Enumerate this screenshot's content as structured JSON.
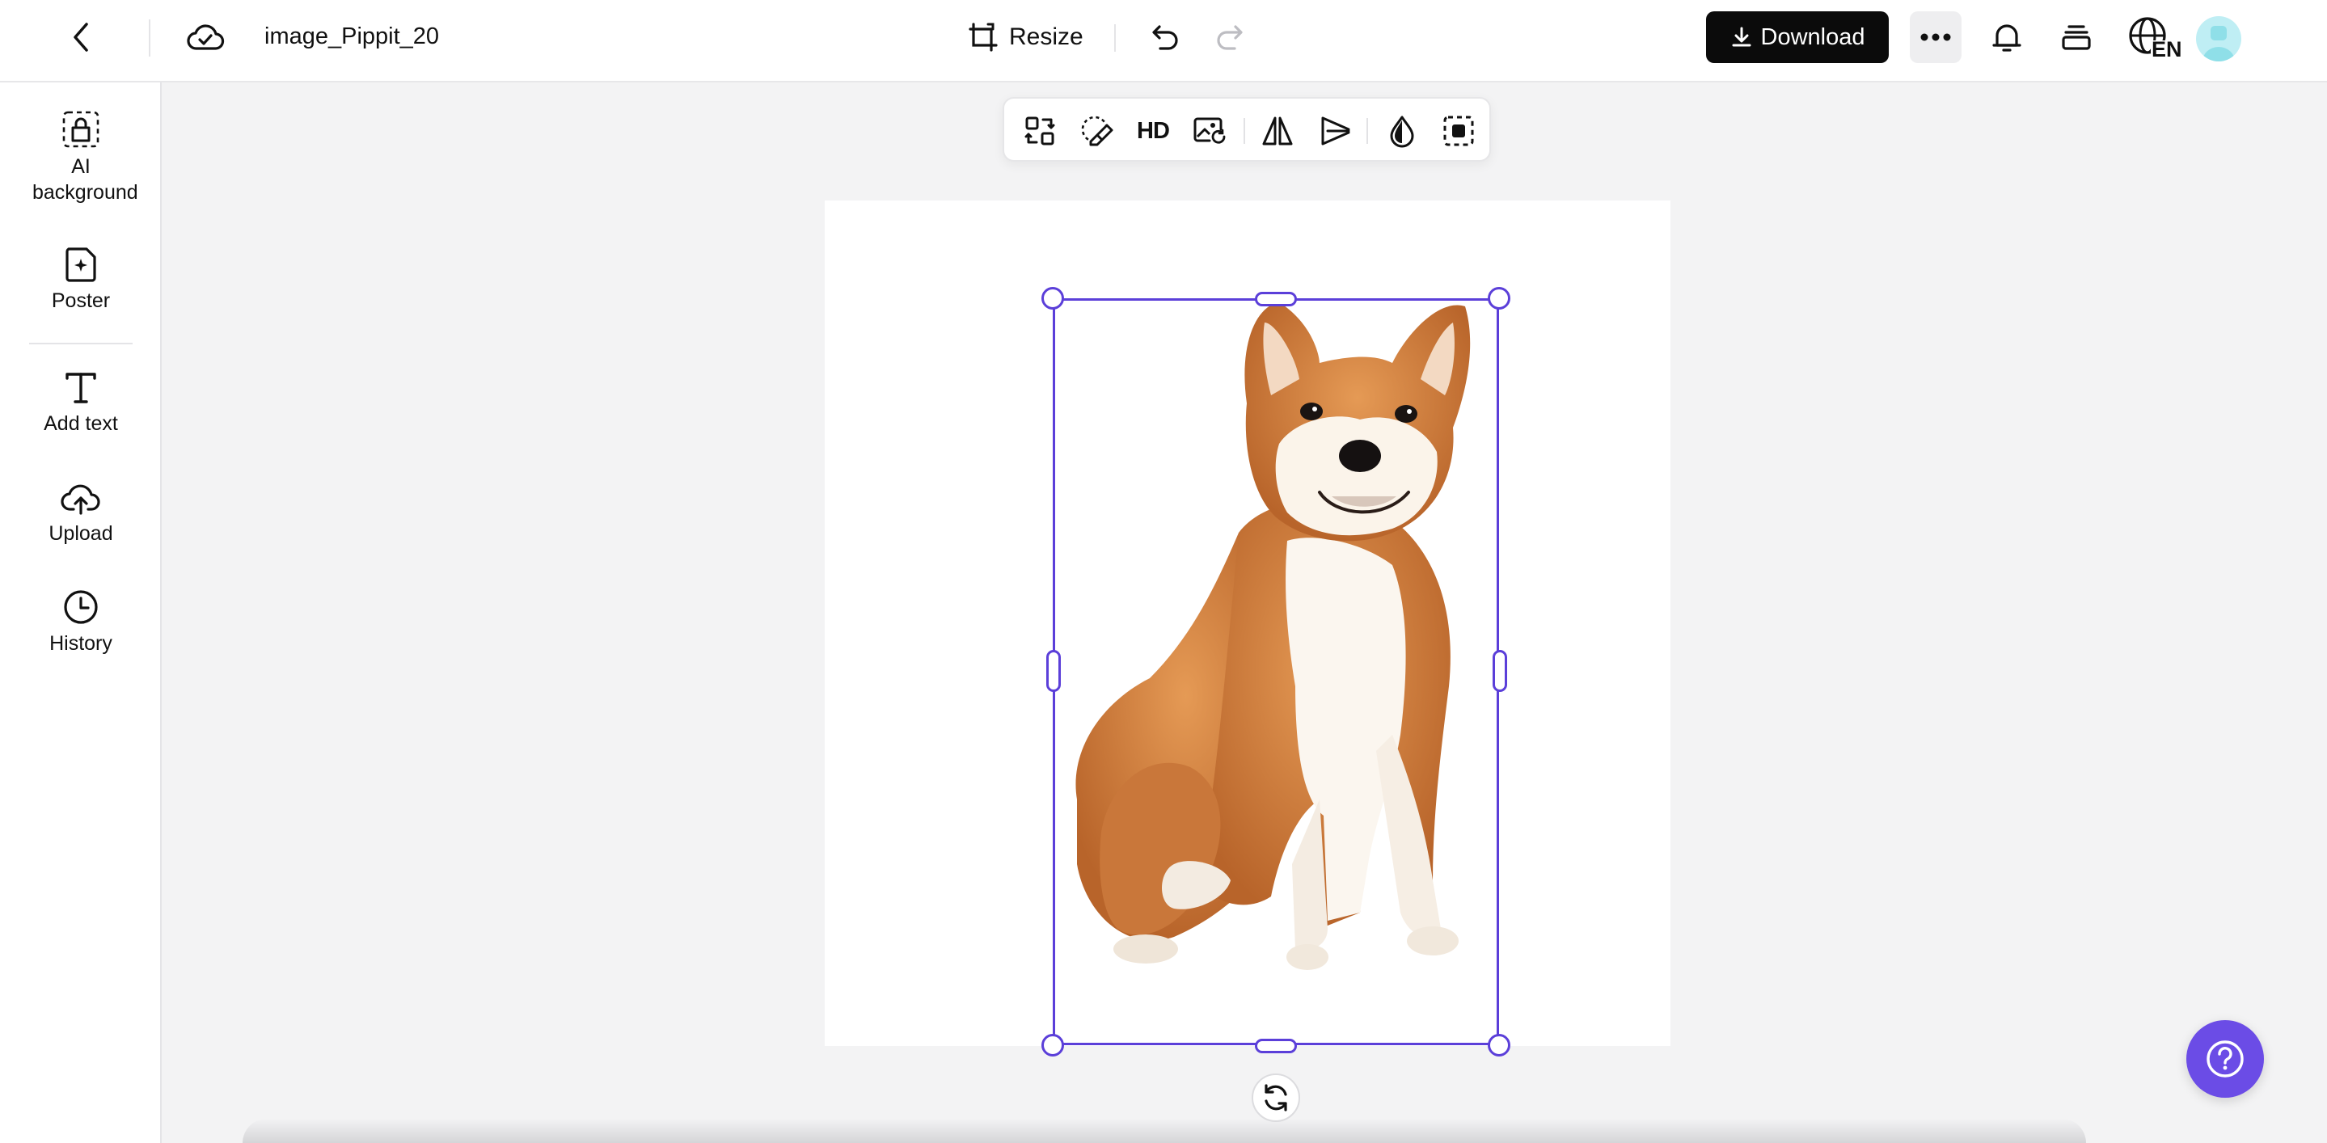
{
  "header": {
    "back_icon": "chevron-left-icon",
    "cloud_icon": "cloud-check-icon",
    "file_title": "image_Pippit_20",
    "resize_label": "Resize",
    "undo_icon": "undo-icon",
    "redo_icon": "redo-icon",
    "download_label": "Download",
    "more_icon": "more-icon",
    "notifications_icon": "bell-icon",
    "layers_icon": "layers-icon",
    "language_label": "EN",
    "accent_color": "#5b3fd9"
  },
  "sidebar": {
    "items": [
      {
        "label": "AI background",
        "icon": "ai-background-icon"
      },
      {
        "label": "Poster",
        "icon": "poster-icon"
      },
      {
        "label": "Add text",
        "icon": "text-icon"
      },
      {
        "label": "Upload",
        "icon": "upload-icon"
      },
      {
        "label": "History",
        "icon": "history-icon"
      }
    ]
  },
  "floating_toolbar": {
    "hd_label": "HD",
    "tools": [
      "replace-icon",
      "eraser-icon",
      "hd-upscale",
      "image-retouch-icon",
      "flip-icon",
      "align-icon",
      "opacity-icon",
      "remove-background-icon"
    ]
  },
  "canvas": {
    "image_subject": "shiba-inu-dog",
    "background_color": "#ffffff"
  },
  "help_icon": "question-icon"
}
